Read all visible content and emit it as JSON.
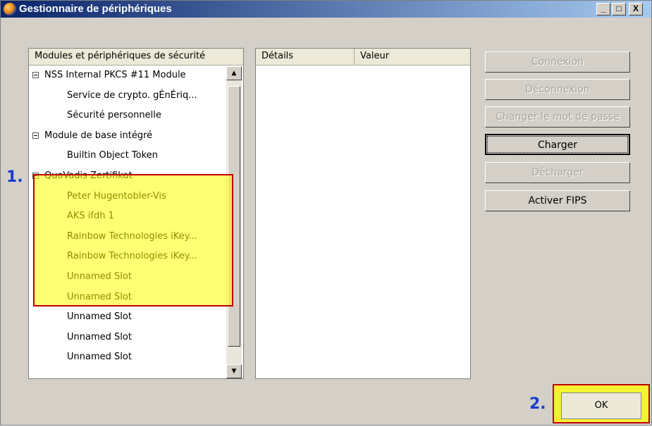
{
  "window": {
    "title": "Gestionnaire de périphériques"
  },
  "title_buttons": {
    "minimize": "_",
    "maximize": "□",
    "close": "X"
  },
  "modules": {
    "header": "Modules et périphériques de sécurité",
    "items": [
      {
        "label": "NSS Internal PKCS #11 Module",
        "level": 0
      },
      {
        "label": "Service de crypto. gÉnÉriq...",
        "level": 1
      },
      {
        "label": "Sécurité personnelle",
        "level": 1
      },
      {
        "label": "Module de base intégré",
        "level": 0
      },
      {
        "label": "Builtin Object Token",
        "level": 1
      },
      {
        "label": "QuoVadis Zertifikat",
        "level": 0
      },
      {
        "label": "Peter Hugentobler-Vis",
        "level": 1
      },
      {
        "label": "AKS ifdh 1",
        "level": 1
      },
      {
        "label": "Rainbow Technologies iKey...",
        "level": 1
      },
      {
        "label": "Rainbow Technologies iKey...",
        "level": 1
      },
      {
        "label": "Unnamed Slot",
        "level": 1
      },
      {
        "label": "Unnamed Slot",
        "level": 1
      },
      {
        "label": "Unnamed Slot",
        "level": 1
      },
      {
        "label": "Unnamed Slot",
        "level": 1
      },
      {
        "label": "Unnamed Slot",
        "level": 1
      }
    ]
  },
  "details": {
    "col_details": "Détails",
    "col_valeur": "Valeur"
  },
  "buttons": {
    "connexion": "Connexion",
    "deconnexion": "Déconnexion",
    "changer_mdp": "Changer le mot de passe",
    "charger": "Charger",
    "decharger": "Décharger",
    "activer_fips": "Activer FIPS",
    "ok": "OK"
  },
  "annotations": {
    "step1": "1.",
    "step2": "2."
  },
  "colors": {
    "highlight": "#ffff00",
    "highlight_border": "#c00000",
    "marker": "#1a3ccd",
    "titlebar": "#0a246a"
  }
}
